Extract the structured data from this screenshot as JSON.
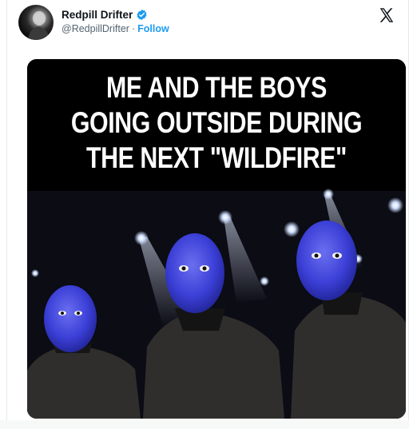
{
  "tweet": {
    "author": {
      "display_name": "Redpill Drifter",
      "handle": "@RedpillDrifter",
      "separator": "·",
      "follow_label": "Follow",
      "verified_color": "#1d9bf0"
    },
    "platform_icon": "x-logo-icon",
    "media": {
      "caption_lines": [
        "ME AND THE BOYS",
        "GOING OUTSIDE DURING",
        "THE NEXT \"WILDFIRE\""
      ],
      "figure_color": "#3b3fd6",
      "background_color": "#000000"
    }
  },
  "colors": {
    "text_primary": "#0f1419",
    "text_secondary": "#536471",
    "accent": "#1d9bf0"
  }
}
